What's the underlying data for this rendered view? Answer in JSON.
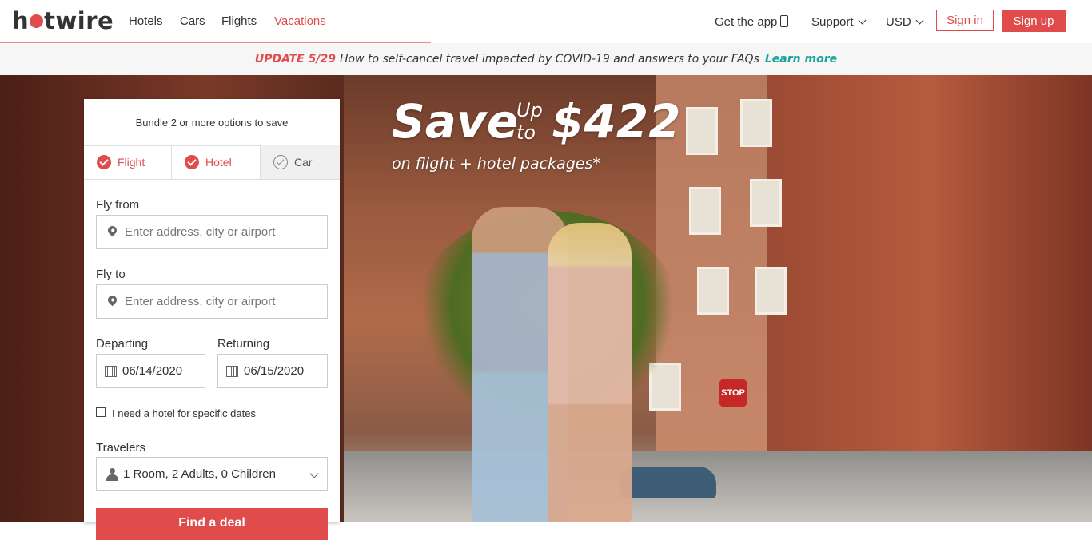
{
  "brand": {
    "logo_pre": "h",
    "logo_post": "twire"
  },
  "nav": {
    "hotels": "Hotels",
    "cars": "Cars",
    "flights": "Flights",
    "vacations": "Vacations"
  },
  "header_right": {
    "get_app": "Get the app",
    "support": "Support",
    "currency": "USD",
    "sign_in": "Sign in",
    "sign_up": "Sign up"
  },
  "banner": {
    "update": "UPDATE 5/29",
    "text": "How to self-cancel travel impacted by COVID-19 and answers to your FAQs",
    "link": "Learn more"
  },
  "promo": {
    "save": "Save",
    "up": "Up",
    "to": "to",
    "amount": "$422",
    "subline": "on flight + hotel packages*"
  },
  "form": {
    "heading": "Bundle 2 or more options to save",
    "tabs": [
      {
        "label": "Flight",
        "selected": true
      },
      {
        "label": "Hotel",
        "selected": true
      },
      {
        "label": "Car",
        "selected": false
      }
    ],
    "fly_from_label": "Fly from",
    "fly_from_placeholder": "Enter address, city or airport",
    "fly_to_label": "Fly to",
    "fly_to_placeholder": "Enter address, city or airport",
    "departing_label": "Departing",
    "departing_value": "06/14/2020",
    "returning_label": "Returning",
    "returning_value": "06/15/2020",
    "hotel_dates_label": "I need a hotel for specific dates",
    "travelers_label": "Travelers",
    "travelers_value": "1 Room, 2 Adults, 0 Children",
    "submit": "Find a deal"
  },
  "colors": {
    "accent": "#e04c4c",
    "link": "#1aa39a"
  },
  "hero_sign": "STOP"
}
